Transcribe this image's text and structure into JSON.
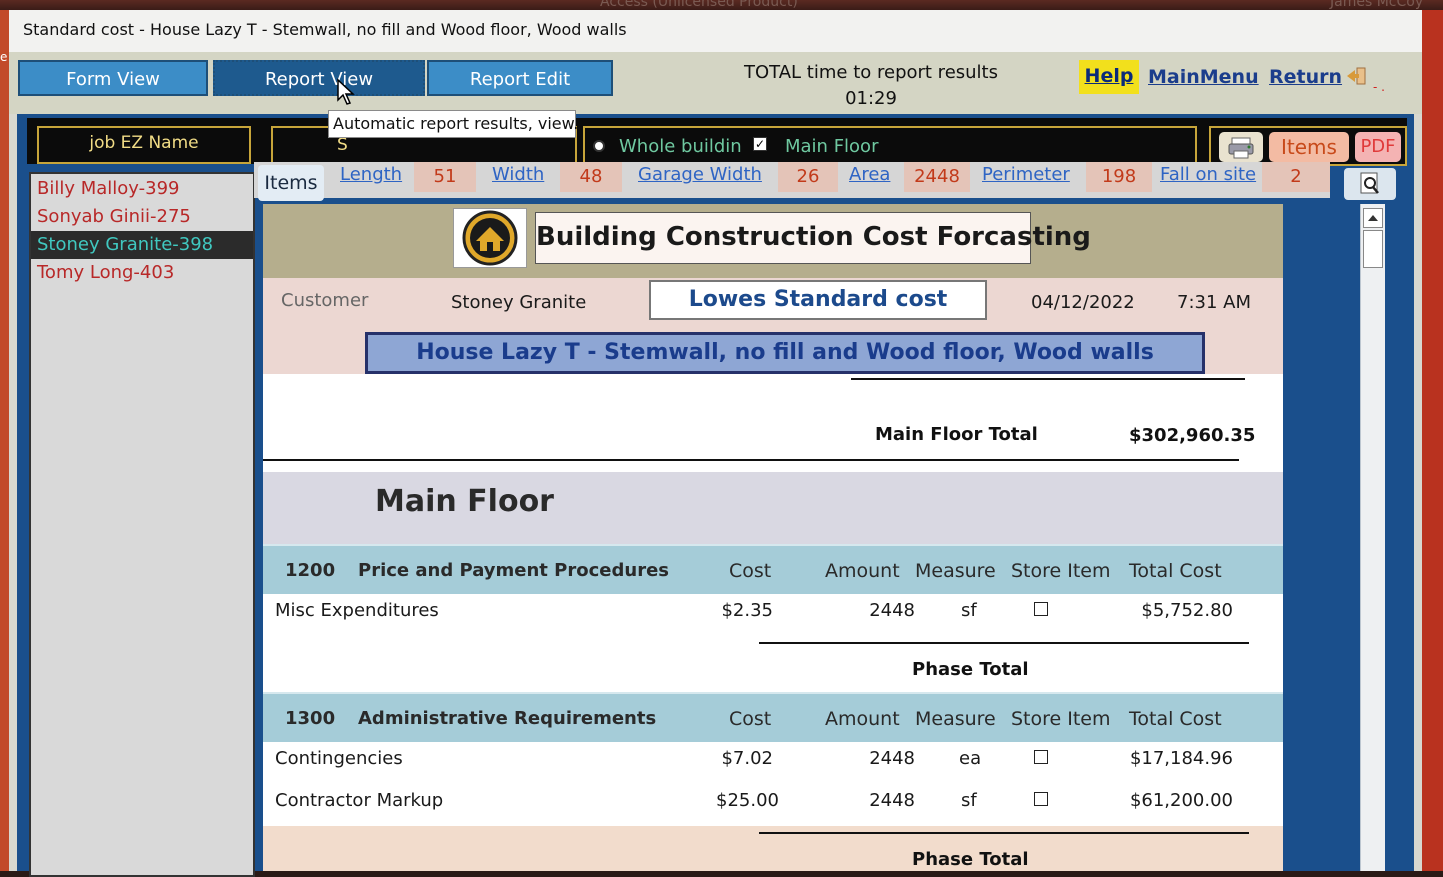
{
  "app": {
    "window_title": "Standard cost - House Lazy T - Stemwall, no fill and Wood floor, Wood walls",
    "background_title": "Access (Unlicensed Product)",
    "background_user": "James McCoy"
  },
  "ribbon": {
    "tabs": [
      "Form View",
      "Report View",
      "Report Edit"
    ],
    "selected_tab": "Report View",
    "total_time_label": "TOTAL time to report results",
    "total_time_value": "01:29",
    "help": "Help",
    "main_menu": "MainMenu",
    "return": "Return"
  },
  "toolbar": {
    "job_name_label": "job EZ Name",
    "search_label": "S",
    "scope_option1": "Whole buildin",
    "scope_option2": "Main Floor",
    "items_button": "Items",
    "pdf_button": "PDF"
  },
  "tooltip": "Automatic report results, view.",
  "jobs": [
    "Billy Malloy-399",
    "Sonyab Ginii-275",
    "Stoney Granite-398",
    "Tomy Long-403"
  ],
  "selected_job": "Stoney Granite-398",
  "dims": {
    "items_tab": "Items",
    "length_label": "Length",
    "length": "51",
    "width_label": "Width",
    "width": "48",
    "garage_width_label": "Garage Width",
    "garage_width": "26",
    "area_label": "Area",
    "area": "2448",
    "perimeter_label": "Perimeter",
    "perimeter": "198",
    "fall_label": "Fall on site",
    "fall": "2"
  },
  "report": {
    "title": "Building Construction Cost Forcasting",
    "customer_label": "Customer",
    "customer": "Stoney Granite",
    "cost_basis": "Lowes Standard cost",
    "date": "04/12/2022",
    "time": "7:31 AM",
    "project": "House Lazy T - Stemwall, no fill and Wood floor, Wood walls",
    "main_floor_total_label": "Main Floor Total",
    "main_floor_total": "$302,960.35",
    "section_title": "Main Floor",
    "columns": [
      "Cost",
      "Amount",
      "Measure",
      "Store Item",
      "Total Cost"
    ],
    "phase_total_label": "Phase Total",
    "phases": [
      {
        "code": "1200",
        "name": "Price and Payment Procedures",
        "rows": [
          {
            "item": "Misc Expenditures",
            "cost": "$2.35",
            "amount": "2448",
            "measure": "sf",
            "store": false,
            "total": "$5,752.80"
          }
        ]
      },
      {
        "code": "1300",
        "name": "Administrative Requirements",
        "rows": [
          {
            "item": "Contingencies",
            "cost": "$7.02",
            "amount": "2448",
            "measure": "ea",
            "store": false,
            "total": "$17,184.96"
          },
          {
            "item": "Contractor Markup",
            "cost": "$25.00",
            "amount": "2448",
            "measure": "sf",
            "store": false,
            "total": "$61,200.00"
          }
        ]
      }
    ]
  },
  "colors": {
    "ribbon_tab": "#3c8dc7",
    "help_bg": "#f2e01c",
    "link": "#1b3d8c",
    "job_text": "#b82828",
    "selected_job_text": "#40c8c0",
    "phase_header_bg": "#a5ccd8",
    "dim_value_bg": "#e4c4b8"
  },
  "icons": [
    "printer-icon",
    "magnifier-icon",
    "exit-arrow-icon",
    "house-logo-icon",
    "mouse-cursor-icon"
  ]
}
